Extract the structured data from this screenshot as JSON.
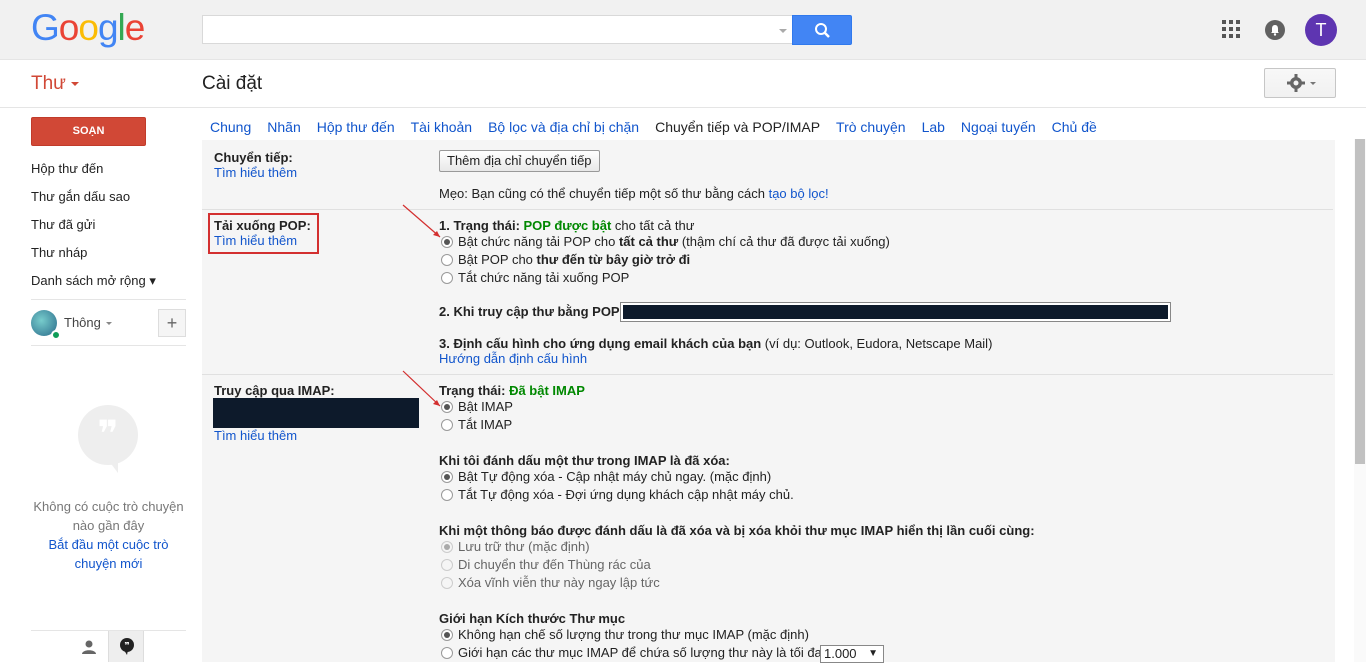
{
  "header": {
    "logo_letters": [
      {
        "ch": "G",
        "color": "#4285f4"
      },
      {
        "ch": "o",
        "color": "#ea4335"
      },
      {
        "ch": "o",
        "color": "#fbbc05"
      },
      {
        "ch": "g",
        "color": "#4285f4"
      },
      {
        "ch": "l",
        "color": "#34a853"
      },
      {
        "ch": "e",
        "color": "#ea4335"
      }
    ],
    "avatar_letter": "T"
  },
  "subbar": {
    "mail_label": "Thư",
    "page_title": "Cài đặt"
  },
  "sidebar": {
    "compose_label": "SOẠN",
    "items": [
      {
        "label": "Hộp thư đến"
      },
      {
        "label": "Thư gắn dấu sao"
      },
      {
        "label": "Thư đã gửi"
      },
      {
        "label": "Thư nháp"
      },
      {
        "label": "Danh sách mở rộng ▾"
      }
    ],
    "hangouts_user": "Thông",
    "no_chat_text": "Không có cuộc trò chuyện nào gần đây",
    "start_chat_link": "Bắt đầu một cuộc trò chuyện mới"
  },
  "tabs": [
    {
      "label": "Chung",
      "active": false
    },
    {
      "label": "Nhãn",
      "active": false
    },
    {
      "label": "Hộp thư đến",
      "active": false
    },
    {
      "label": "Tài khoản",
      "active": false
    },
    {
      "label": "Bộ lọc và địa chỉ bị chặn",
      "active": false
    },
    {
      "label": "Chuyển tiếp và POP/IMAP",
      "active": true
    },
    {
      "label": "Trò chuyện",
      "active": false
    },
    {
      "label": "Lab",
      "active": false
    },
    {
      "label": "Ngoại tuyến",
      "active": false
    },
    {
      "label": "Chủ đề",
      "active": false
    }
  ],
  "forwarding": {
    "label": "Chuyển tiếp:",
    "learn_more": "Tìm hiểu thêm",
    "add_button": "Thêm địa chỉ chuyển tiếp",
    "tip_prefix": "Mẹo: Bạn cũng có thể chuyển tiếp một số thư bằng cách ",
    "tip_link": "tạo bộ lọc!"
  },
  "pop": {
    "label": "Tải xuống POP:",
    "learn_more": "Tìm hiểu thêm",
    "status_prefix": "1. Trạng thái: ",
    "status_value": "POP được bật",
    "status_suffix": " cho tất cả thư",
    "opt1_a": "Bật chức năng tải POP cho ",
    "opt1_b": "tất cả thư",
    "opt1_c": " (thậm chí cả thư đã được tải xuống)",
    "opt2_a": "Bật POP cho ",
    "opt2_b": "thư đến từ bây giờ trở đi",
    "opt3": "Tắt chức năng tải xuống POP",
    "access_label": "2. Khi truy cập thư bằng POP",
    "config_label": "3. Định cấu hình cho ứng dụng email khách của bạn",
    "config_examples": " (ví dụ: Outlook, Eudora, Netscape Mail)",
    "config_link": "Hướng dẫn định cấu hình"
  },
  "imap": {
    "label": "Truy cập qua IMAP:",
    "learn_more": "Tìm hiểu thêm",
    "status_prefix": "Trạng thái: ",
    "status_value": "Đã bật IMAP",
    "enable": "Bật IMAP",
    "disable": "Tắt IMAP",
    "deleted_heading": "Khi tôi đánh dấu một thư trong IMAP là đã xóa:",
    "auto_on": "Bật Tự động xóa - Cập nhật máy chủ ngay. (mặc định)",
    "auto_off": "Tắt Tự động xóa - Đợi ứng dụng khách cập nhật máy chủ.",
    "expunge_heading": "Khi một thông báo được đánh dấu là đã xóa và bị xóa khỏi thư mục IMAP hiển thị lần cuối cùng:",
    "expunge_archive": "Lưu trữ thư (mặc định)",
    "expunge_trash": "Di chuyển thư đến Thùng rác của",
    "expunge_delete": "Xóa vĩnh viễn thư này ngay lập tức",
    "folder_heading": "Giới hạn Kích thước Thư mục",
    "folder_nolimit": "Không hạn chế số lượng thư trong thư mục IMAP (mặc định)",
    "folder_limit": "Giới hạn các thư mục IMAP để chứa số lượng thư này là tối đa",
    "folder_limit_value": "1.000"
  }
}
